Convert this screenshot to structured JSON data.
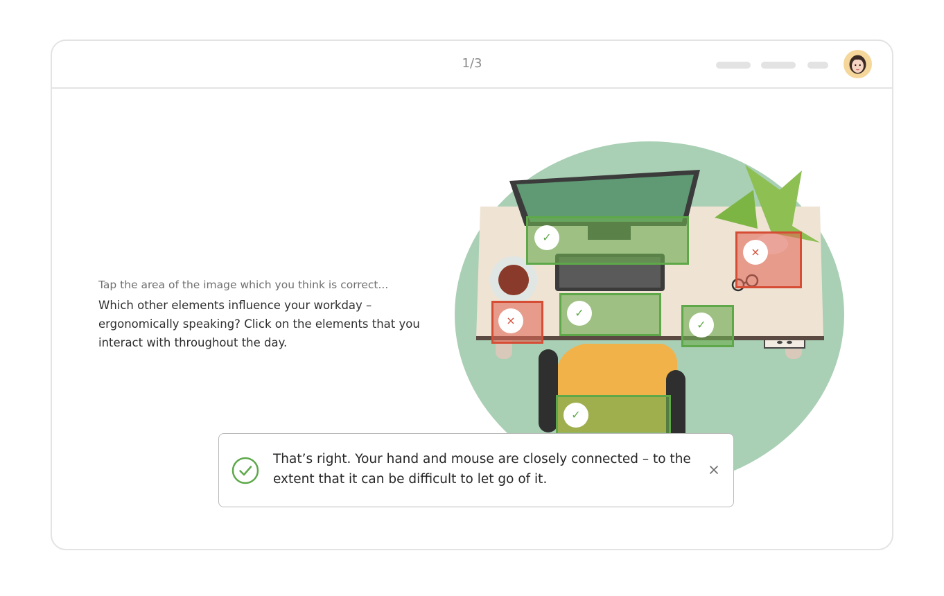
{
  "header": {
    "progress_counter": "1/3",
    "avatar_icon": "user-avatar-icon"
  },
  "question": {
    "instruction": "Tap the area of the image which you think is correct...",
    "prompt": "Which other elements influence your workday – ergonomically speaking? Click on the elements that you interact with throughout the day."
  },
  "scene": {
    "background_color": "#a9cfb4",
    "hotspots": [
      {
        "item": "monitor",
        "state": "correct",
        "mark_icon": "check-icon"
      },
      {
        "item": "plant",
        "state": "incorrect",
        "mark_icon": "cross-icon"
      },
      {
        "item": "coffee-cup",
        "state": "incorrect",
        "mark_icon": "cross-icon"
      },
      {
        "item": "keyboard",
        "state": "correct",
        "mark_icon": "check-icon"
      },
      {
        "item": "mouse",
        "state": "correct",
        "mark_icon": "check-icon"
      },
      {
        "item": "chair",
        "state": "correct",
        "mark_icon": "check-icon"
      }
    ],
    "marks": {
      "check": "✓",
      "cross": "×"
    }
  },
  "feedback": {
    "message": "That’s right. Your hand and mouse are closely connected – to the extent that it can be difficult to let go of it.",
    "status_icon": "check-circle-icon",
    "close_icon": "close-icon"
  },
  "colors": {
    "correct": "#5ea84a",
    "incorrect": "#d64d36",
    "border": "#e3e3e3"
  }
}
